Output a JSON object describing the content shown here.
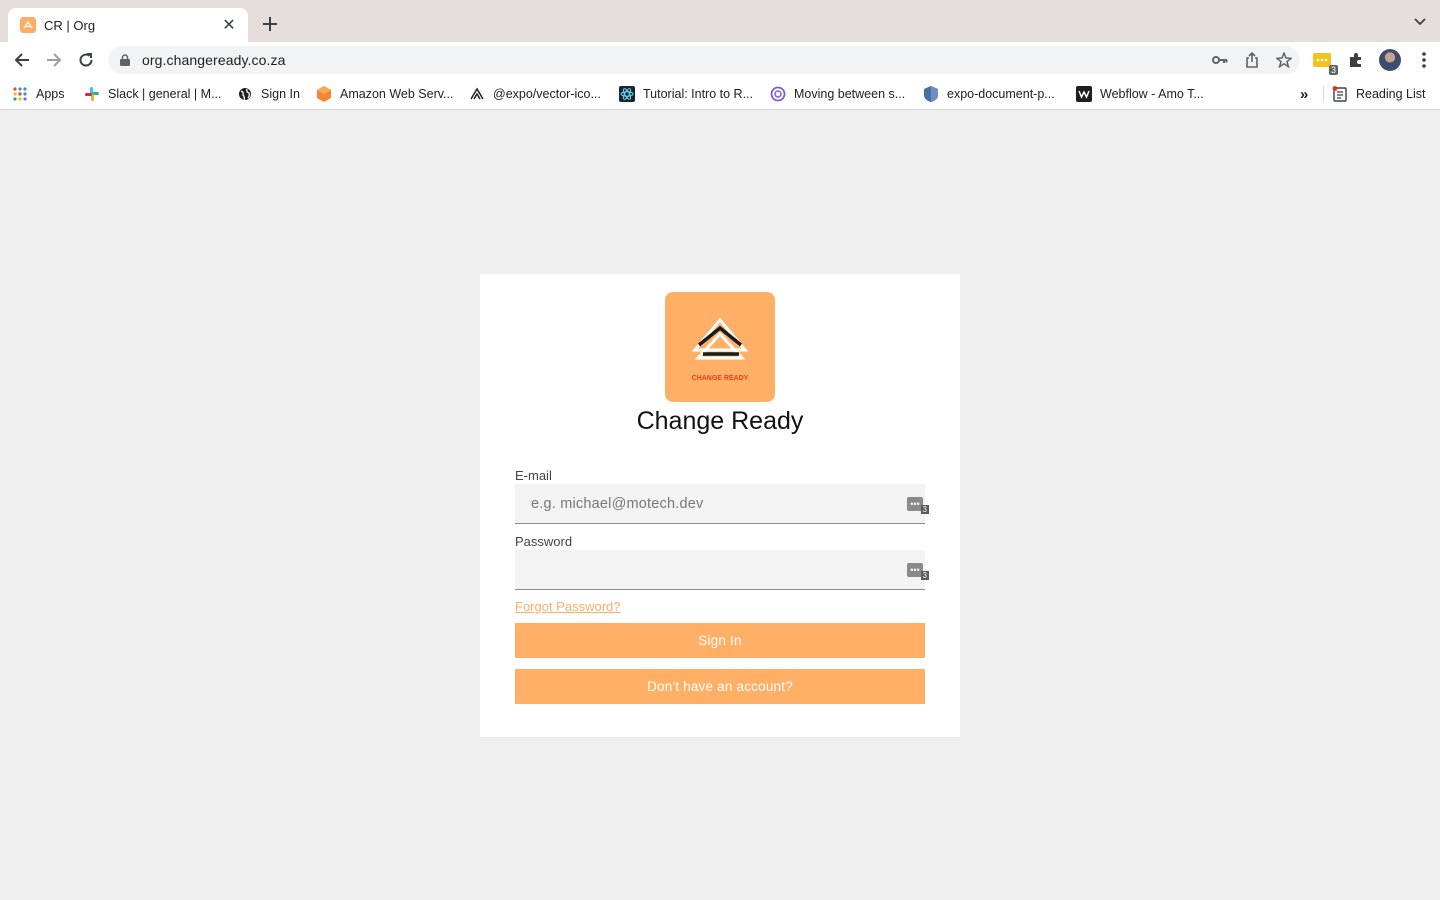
{
  "browser": {
    "tab": {
      "title": "CR | Org",
      "close": "✕"
    },
    "url": "org.changeready.co.za",
    "extension_badge": "3",
    "bookmarks": [
      {
        "label": "Apps",
        "icon": "apps-grid-icon"
      },
      {
        "label": "Slack | general | M...",
        "icon": "slack-icon"
      },
      {
        "label": "Sign In",
        "icon": "globe-icon"
      },
      {
        "label": "Amazon Web Serv...",
        "icon": "aws-icon"
      },
      {
        "label": "@expo/vector-ico...",
        "icon": "expo-icon"
      },
      {
        "label": "Tutorial: Intro to R...",
        "icon": "react-icon"
      },
      {
        "label": "Moving between s...",
        "icon": "circle-icon"
      },
      {
        "label": "expo-document-p...",
        "icon": "shield-icon"
      },
      {
        "label": "Webflow - Amo T...",
        "icon": "webflow-icon"
      }
    ],
    "overflow": "»",
    "reading_list": "Reading List"
  },
  "login": {
    "logo_text": "CHANGE READY",
    "title": "Change Ready",
    "email_label": "E-mail",
    "email_placeholder": "e.g. michael@motech.dev",
    "password_label": "Password",
    "password_placeholder": "",
    "field_badge": "3",
    "forgot": "Forgot Password?",
    "signin": "Sign In",
    "signup": "Don't have an account?"
  },
  "colors": {
    "accent": "#ffaf66",
    "background": "#efefef",
    "card": "#ffffff"
  }
}
